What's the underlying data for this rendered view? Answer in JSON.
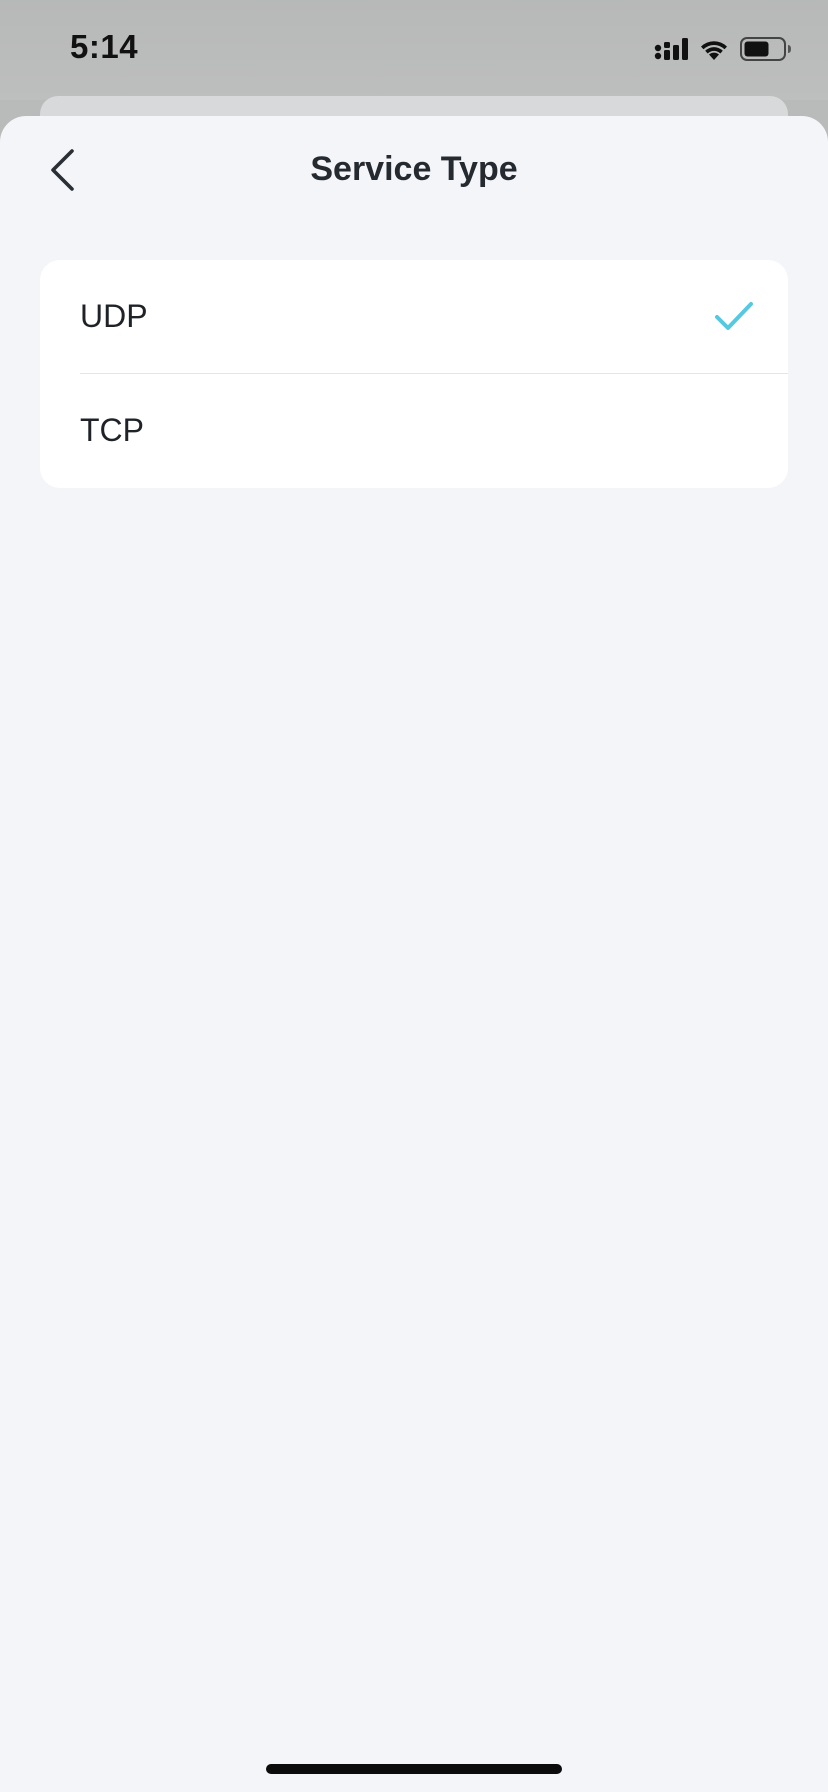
{
  "status_bar": {
    "time": "5:14",
    "icons": [
      "cellular-signal-icon",
      "wifi-icon",
      "battery-icon"
    ]
  },
  "nav": {
    "title": "Service Type",
    "back_icon": "chevron-left-icon"
  },
  "options": [
    {
      "label": "UDP",
      "selected": true
    },
    {
      "label": "TCP",
      "selected": false
    }
  ],
  "colors": {
    "accent": "#56c8e0",
    "background": "#f4f5f9",
    "card": "#ffffff",
    "text": "#1f2328"
  }
}
